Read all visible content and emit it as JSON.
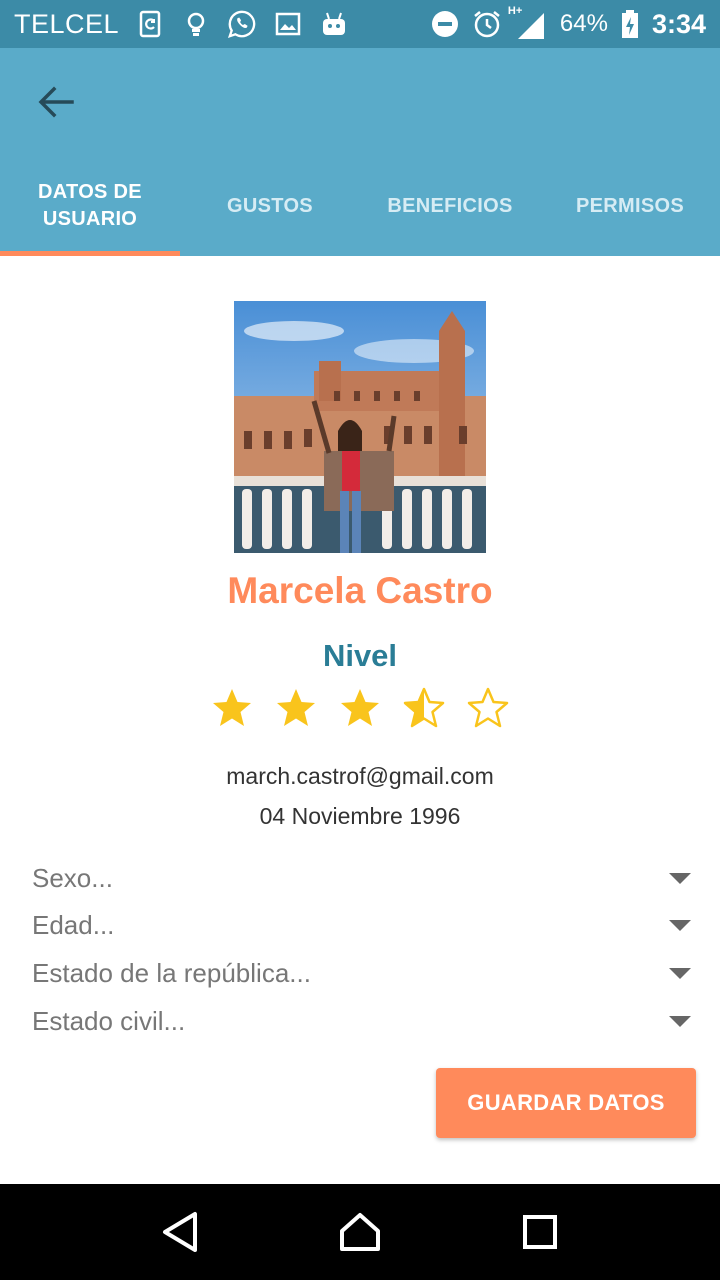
{
  "status_bar": {
    "carrier": "TELCEL",
    "battery_percent": "64%",
    "time": "3:34",
    "network_label": "H+",
    "icons": [
      "sim-icon",
      "lightbulb-icon",
      "whatsapp-icon",
      "image-icon",
      "android-icon",
      "dnd-icon",
      "alarm-icon",
      "signal-icon",
      "battery-icon"
    ]
  },
  "app_bar": {
    "back_icon": "arrow-left-icon",
    "tabs": [
      {
        "label": "DATOS DE\nUSUARIO",
        "active": true
      },
      {
        "label": "GUSTOS",
        "active": false
      },
      {
        "label": "BENEFICIOS",
        "active": false
      },
      {
        "label": "PERMISOS",
        "active": false
      }
    ]
  },
  "profile": {
    "name": "Marcela Castro",
    "level_label": "Nivel",
    "rating": 3.5,
    "rating_max": 5,
    "email": "march.castrof@gmail.com",
    "birthdate": "04 Noviembre 1996"
  },
  "form": {
    "dropdowns": [
      {
        "placeholder": "Sexo..."
      },
      {
        "placeholder": "Edad..."
      },
      {
        "placeholder": "Estado de la república..."
      },
      {
        "placeholder": "Estado civil..."
      }
    ],
    "save_label": "GUARDAR DATOS"
  },
  "colors": {
    "status_bar": "#3c8ba7",
    "app_bar": "#5aabc9",
    "accent": "#ff8a5b",
    "level_text": "#2a7d96",
    "star": "#f9c41c"
  },
  "nav_bar": {
    "buttons": [
      "back-triangle-icon",
      "home-icon",
      "recents-icon"
    ]
  }
}
